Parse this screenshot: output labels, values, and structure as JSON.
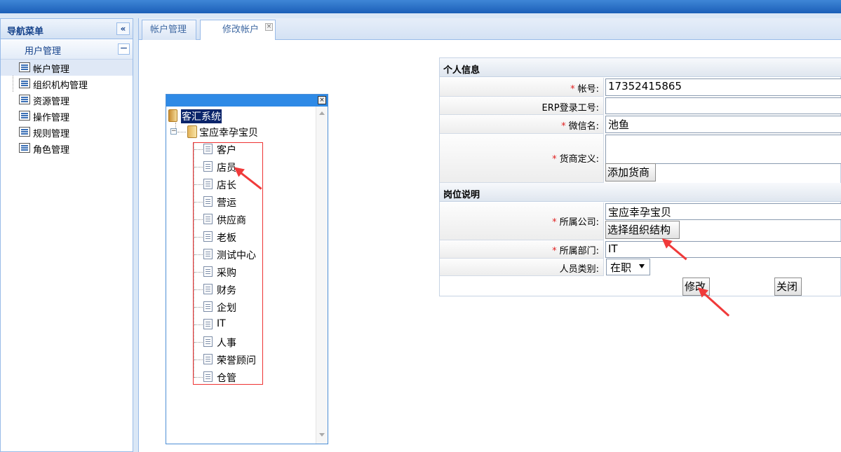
{
  "sidebar": {
    "title": "导航菜单",
    "collapse_icon": "«",
    "group": {
      "label": "用户管理",
      "toggle": "−"
    },
    "items": [
      {
        "label": "帐户管理"
      },
      {
        "label": "组织机构管理"
      },
      {
        "label": "资源管理"
      },
      {
        "label": "操作管理"
      },
      {
        "label": "规则管理"
      },
      {
        "label": "角色管理"
      }
    ]
  },
  "tabs": [
    {
      "label": "帐户管理"
    },
    {
      "label": "修改帐户",
      "close": "×"
    }
  ],
  "tree": {
    "close": "×",
    "root": "客汇系统",
    "company": "宝应幸孕宝贝",
    "expander": "−",
    "children": [
      "客户",
      "店员",
      "店长",
      "营运",
      "供应商",
      "老板",
      "测试中心",
      "采购",
      "财务",
      "企划",
      "IT",
      "人事",
      "荣誉顾问",
      "仓管"
    ]
  },
  "form": {
    "section_personal": "个人信息",
    "section_position": "岗位说明",
    "req": "*",
    "account_label": "帐号:",
    "account_value": "17352415865",
    "erp_label": "ERP登录工号:",
    "erp_value": "",
    "wechat_label": "微信名:",
    "wechat_value": "池鱼",
    "supplier_label": "货商定义:",
    "supplier_value": "",
    "add_supplier_btn": "添加货商",
    "company_label": "所属公司:",
    "company_value": "宝应幸孕宝贝",
    "select_org_btn": "选择组织结构",
    "dept_label": "所属部门:",
    "dept_value": "IT",
    "category_label": "人员类别:",
    "category_value": "在职",
    "modify_btn": "修改",
    "close_btn": "关闭"
  },
  "colors": {
    "annotation": "#f03a3a",
    "accent": "#1b5fb8"
  }
}
